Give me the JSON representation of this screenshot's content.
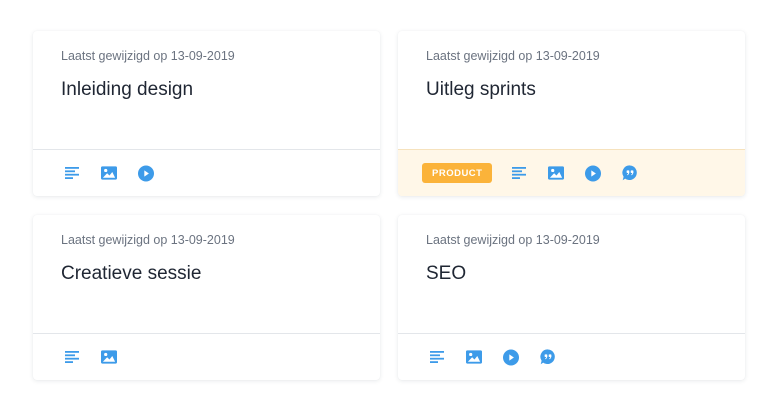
{
  "colors": {
    "accent": "#3d9be9",
    "badge": "#fbb33a",
    "highlight_bg": "#fff7e8"
  },
  "cards": [
    {
      "meta": "Laatst gewijzigd op 13-09-2019",
      "title": "Inleiding design",
      "badge": "",
      "icons": [
        "text-icon",
        "image-icon",
        "play-icon"
      ]
    },
    {
      "meta": "Laatst gewijzigd op 13-09-2019",
      "title": "Uitleg sprints",
      "badge": "PRODUCT",
      "icons": [
        "text-icon",
        "image-icon",
        "play-icon",
        "quote-icon"
      ]
    },
    {
      "meta": "Laatst gewijzigd op 13-09-2019",
      "title": "Creatieve sessie",
      "badge": "",
      "icons": [
        "text-icon",
        "image-icon"
      ]
    },
    {
      "meta": "Laatst gewijzigd op 13-09-2019",
      "title": "SEO",
      "badge": "",
      "icons": [
        "text-icon",
        "image-icon",
        "play-icon",
        "quote-icon"
      ]
    }
  ]
}
